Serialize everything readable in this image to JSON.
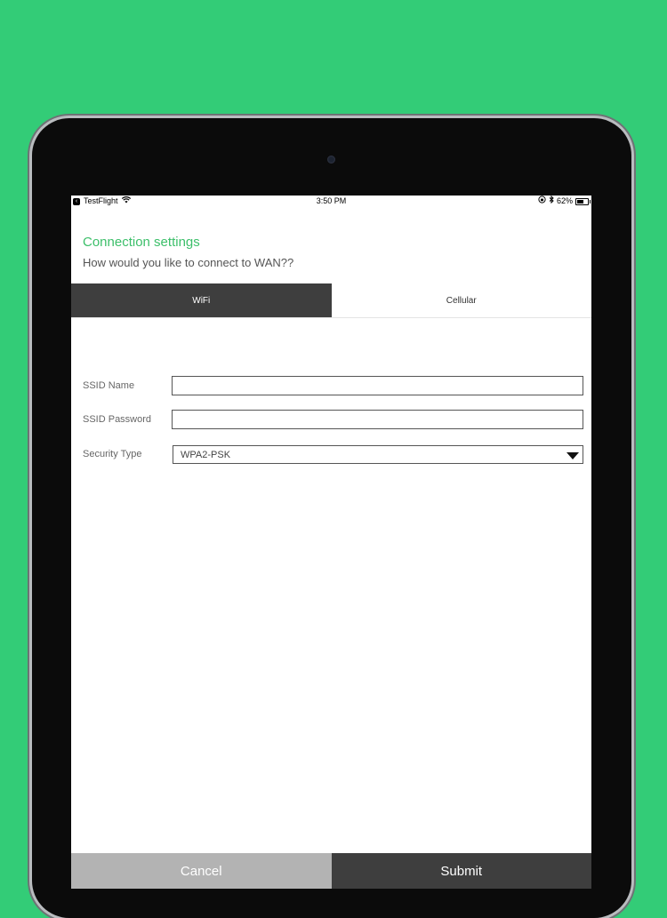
{
  "statusbar": {
    "carrier": "TestFlight",
    "time": "3:50 PM",
    "battery": "62%",
    "battery_level": 0.62
  },
  "header": {
    "title": "Connection settings",
    "subtitle": "How would you like to connect to WAN??"
  },
  "tabs": [
    {
      "label": "WiFi",
      "active": true
    },
    {
      "label": "Cellular",
      "active": false
    }
  ],
  "form": {
    "ssid_name": {
      "label": "SSID Name",
      "value": ""
    },
    "ssid_password": {
      "label": "SSID Password",
      "value": ""
    },
    "security_type": {
      "label": "Security Type",
      "value": "WPA2-PSK"
    }
  },
  "footer": {
    "cancel_label": "Cancel",
    "submit_label": "Submit"
  },
  "colors": {
    "background": "#33cc77",
    "accent": "#3cbf6a",
    "tab_active": "#3e3e3e",
    "cancel": "#b3b3b3"
  }
}
